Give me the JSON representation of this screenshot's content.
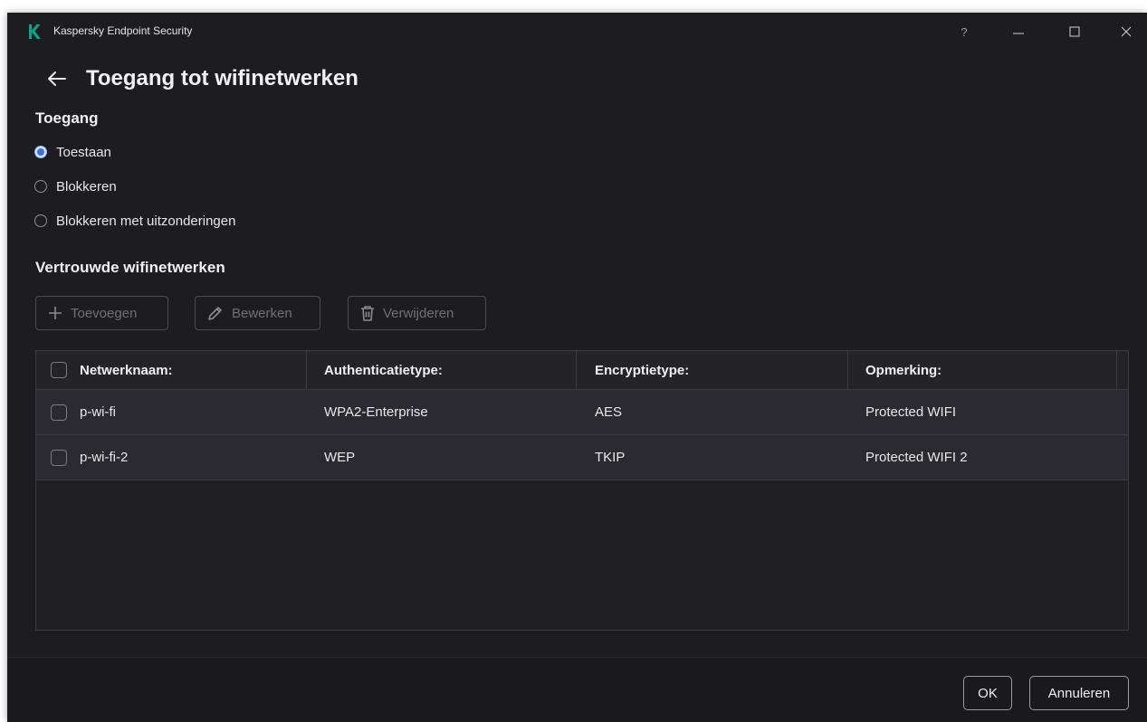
{
  "window": {
    "title": "Kaspersky Endpoint Security",
    "help_label": "?",
    "accent": "#00a88e"
  },
  "header": {
    "title": "Toegang tot wifinetwerken"
  },
  "access": {
    "title": "Toegang",
    "options": [
      {
        "label": "Toestaan",
        "selected": true
      },
      {
        "label": "Blokkeren",
        "selected": false
      },
      {
        "label": "Blokkeren met uitzonderingen",
        "selected": false
      }
    ]
  },
  "trusted": {
    "title": "Vertrouwde wifinetwerken",
    "toolbar": {
      "add_label": "Toevoegen",
      "edit_label": "Bewerken",
      "delete_label": "Verwijderen"
    },
    "columns": [
      "Netwerknaam:",
      "Authenticatietype:",
      "Encryptietype:",
      "Opmerking:"
    ],
    "rows": [
      {
        "name": "p-wi-fi",
        "auth": "WPA2-Enterprise",
        "encryption": "AES",
        "comment": "Protected WIFI"
      },
      {
        "name": "p-wi-fi-2",
        "auth": "WEP",
        "encryption": "TKIP",
        "comment": "Protected WIFI 2"
      }
    ]
  },
  "footer": {
    "ok_label": "OK",
    "cancel_label": "Annuleren"
  }
}
